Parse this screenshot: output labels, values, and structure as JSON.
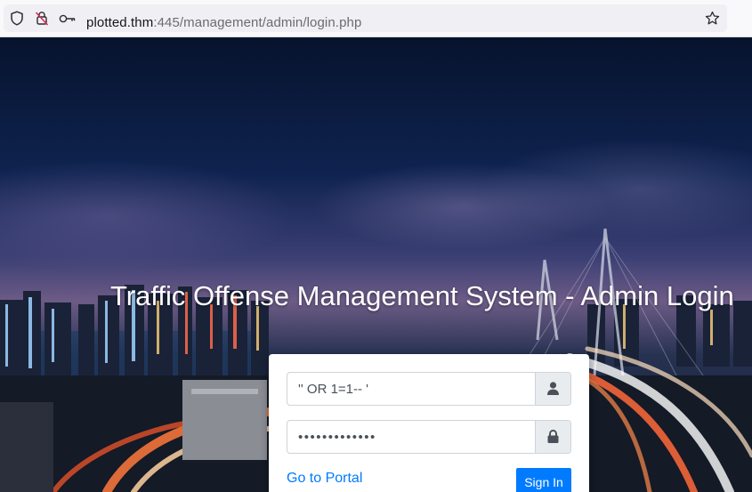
{
  "browser": {
    "url_host": "plotted.thm",
    "url_path": ":445/management/admin/login.php",
    "icons": [
      "shield-icon",
      "connection-not-secure-icon",
      "key-icon",
      "bookmark-star-icon"
    ]
  },
  "page": {
    "title": "Traffic Offense Management System - Admin Login"
  },
  "login": {
    "username_value": "'' OR 1=1-- '",
    "password_value": "•••••••••••••",
    "username_icon": "user-icon",
    "password_icon": "lock-icon",
    "portal_link": "Go to Portal",
    "signin_label": "Sign In"
  },
  "colors": {
    "accent": "#007bff",
    "addon_bg": "#e9ecef"
  }
}
